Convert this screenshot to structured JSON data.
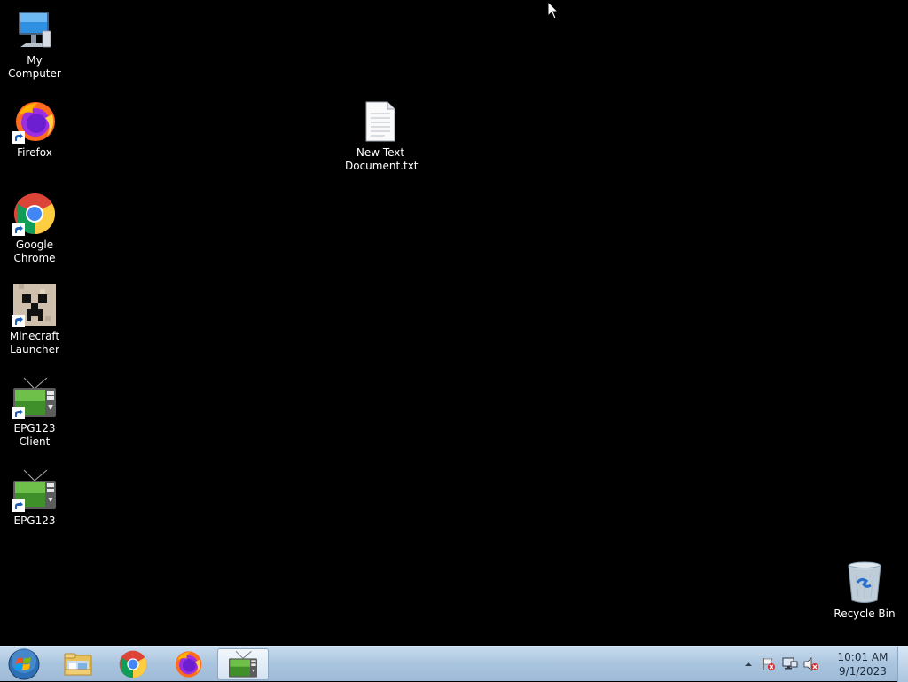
{
  "desktop": {
    "icons": [
      {
        "label": "My Computer",
        "icon": "computer-icon"
      },
      {
        "label": "Firefox",
        "icon": "firefox-icon"
      },
      {
        "label": "Google Chrome",
        "icon": "chrome-icon"
      },
      {
        "label": "Minecraft Launcher",
        "icon": "minecraft-icon"
      },
      {
        "label": "EPG123 Client",
        "icon": "epg123-client-icon"
      },
      {
        "label": "EPG123",
        "icon": "epg123-icon"
      },
      {
        "label": "New Text Document.txt",
        "icon": "text-document-icon"
      },
      {
        "label": "Recycle Bin",
        "icon": "recycle-bin-icon"
      }
    ]
  },
  "taskbar": {
    "start_icon": "windows-start-icon",
    "pinned": [
      {
        "icon": "file-explorer-icon"
      },
      {
        "icon": "chrome-icon"
      },
      {
        "icon": "firefox-icon"
      },
      {
        "icon": "epg123-icon",
        "active": true
      }
    ],
    "tray": {
      "time": "10:01 AM",
      "date": "9/1/2023"
    }
  },
  "colors": {
    "desktop_bg": "#000000",
    "taskbar_top": "#c9dcee",
    "taskbar_bottom": "#9ebad6"
  }
}
